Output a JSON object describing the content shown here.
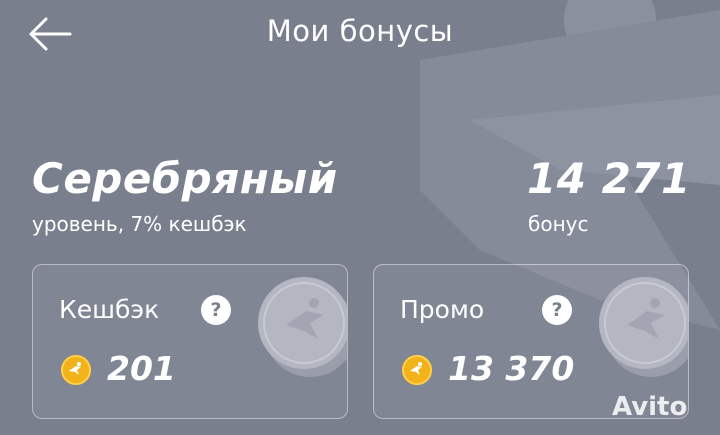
{
  "header": {
    "title": "Мои бонусы",
    "back_icon": "arrow-left-icon"
  },
  "level": {
    "name": "Серебряный",
    "subtitle": "уровень, 7% кешбэк"
  },
  "bonus": {
    "total": "14 271",
    "label": "бонус"
  },
  "cards": [
    {
      "title": "Кешбэк",
      "help": "?",
      "value": "201",
      "icon": "coin-icon"
    },
    {
      "title": "Промо",
      "help": "?",
      "value": "13 370",
      "icon": "coin-icon"
    }
  ],
  "watermark": {
    "text": "Avito"
  },
  "colors": {
    "background": "#7a7f8e",
    "text": "#ffffff",
    "coin": "#f2b31a"
  }
}
